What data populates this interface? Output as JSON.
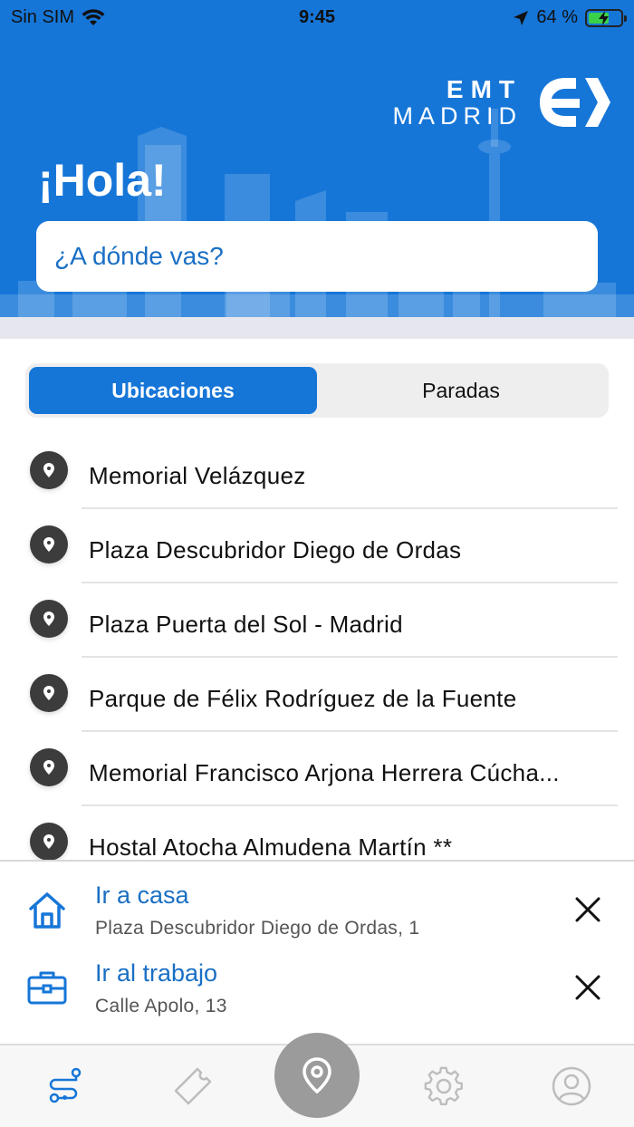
{
  "status_bar": {
    "carrier": "Sin SIM",
    "time": "9:45",
    "battery_percent": "64 %",
    "battery_level": 0.64
  },
  "header": {
    "brand_top": "EMT",
    "brand_bottom": "MADRID",
    "greeting": "¡Hola!",
    "search_placeholder": "¿A dónde vas?"
  },
  "segmented": {
    "tabs": [
      {
        "label": "Ubicaciones",
        "active": true
      },
      {
        "label": "Paradas",
        "active": false
      }
    ]
  },
  "locations": [
    {
      "label": "Memorial Velázquez",
      "icon": "pin-icon"
    },
    {
      "label": "Plaza Descubridor Diego de Ordas",
      "icon": "pin-icon"
    },
    {
      "label": "Plaza Puerta del Sol - Madrid",
      "icon": "pin-icon"
    },
    {
      "label": "Parque de Félix Rodríguez de la Fuente",
      "icon": "pin-icon"
    },
    {
      "label": "Memorial Francisco Arjona Herrera Cúcha...",
      "icon": "pin-icon"
    },
    {
      "label": "Hostal Atocha Almudena Martín **",
      "icon": "pin-icon"
    }
  ],
  "shortcuts": {
    "home": {
      "title": "Ir a casa",
      "address": "Plaza Descubridor Diego de Ordas, 1",
      "icon": "home-icon"
    },
    "work": {
      "title": "Ir al trabajo",
      "address": "Calle Apolo, 13",
      "icon": "briefcase-icon"
    }
  },
  "tabbar": {
    "items": [
      "routes-icon",
      "ticket-icon",
      "location-icon",
      "settings-icon",
      "profile-icon"
    ],
    "active": "routes-icon"
  },
  "colors": {
    "brand_blue": "#1676d8",
    "link_blue": "#1a6fc4",
    "pin_dark": "#3c3c3c"
  }
}
